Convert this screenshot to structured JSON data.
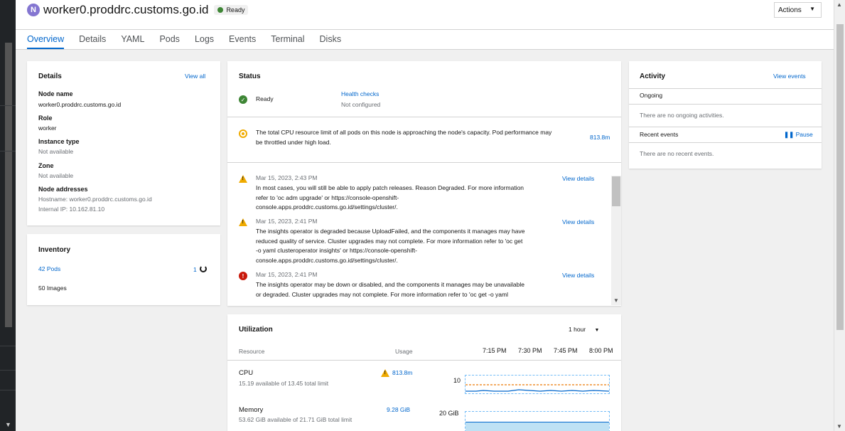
{
  "header": {
    "node_badge": "N",
    "title": "worker0.proddrc.customs.go.id",
    "status": "Ready",
    "actions_label": "Actions"
  },
  "tabs": [
    {
      "label": "Overview",
      "active": true
    },
    {
      "label": "Details"
    },
    {
      "label": "YAML"
    },
    {
      "label": "Pods"
    },
    {
      "label": "Logs"
    },
    {
      "label": "Events"
    },
    {
      "label": "Terminal"
    },
    {
      "label": "Disks"
    }
  ],
  "details": {
    "title": "Details",
    "view_all": "View all",
    "node_name_label": "Node name",
    "node_name": "worker0.proddrc.customs.go.id",
    "role_label": "Role",
    "role": "worker",
    "instance_type_label": "Instance type",
    "instance_type": "Not available",
    "zone_label": "Zone",
    "zone": "Not available",
    "addresses_label": "Node addresses",
    "hostname": "Hostname: worker0.proddrc.customs.go.id",
    "internal_ip": "Internal IP: 10.162.81.10"
  },
  "inventory": {
    "title": "Inventory",
    "pods": "42 Pods",
    "pods_pending": "1",
    "images": "50 Images"
  },
  "status": {
    "title": "Status",
    "ready": "Ready",
    "health_checks": "Health checks",
    "health_status": "Not configured",
    "cpu_alert": "The total CPU resource limit of all pods on this node is approaching the node's capacity. Pod performance may be throttled under high load.",
    "cpu_alert_value": "813.8m",
    "alerts": [
      {
        "severity": "warning",
        "date": "Mar 15, 2023, 2:43 PM",
        "lines": [
          "In most cases, you will still be able to apply patch releases. Reason Degraded. For more information",
          "refer to 'oc adm upgrade' or https://console-openshift-",
          "console.apps.proddrc.customs.go.id/settings/cluster/."
        ],
        "link": "View details"
      },
      {
        "severity": "warning",
        "date": "Mar 15, 2023, 2:41 PM",
        "lines": [
          "The insights operator is degraded because UploadFailed, and the components it manages may have",
          "reduced quality of service. Cluster upgrades may not complete. For more information refer to 'oc get",
          "-o yaml clusteroperator insights' or https://console-openshift-",
          "console.apps.proddrc.customs.go.id/settings/cluster/."
        ],
        "link": "View details"
      },
      {
        "severity": "critical",
        "date": "Mar 15, 2023, 2:41 PM",
        "lines": [
          "The insights operator may be down or disabled, and the components it manages may be unavailable",
          "or degraded. Cluster upgrades may not complete. For more information refer to 'oc get -o yaml"
        ],
        "link": "View details"
      }
    ]
  },
  "activity": {
    "title": "Activity",
    "view_events": "View events",
    "ongoing_label": "Ongoing",
    "ongoing_empty": "There are no ongoing activities.",
    "recent_label": "Recent events",
    "pause": "Pause",
    "recent_empty": "There are no recent events."
  },
  "utilization": {
    "title": "Utilization",
    "range": "1 hour",
    "col_resource": "Resource",
    "col_usage": "Usage",
    "ticks": [
      "7:15 PM",
      "7:30 PM",
      "7:45 PM",
      "8:00 PM"
    ],
    "rows": [
      {
        "name": "CPU",
        "detail": "15.19 available of 13.45 total limit",
        "usage": "813.8m",
        "warning": true,
        "axis_label": "10"
      },
      {
        "name": "Memory",
        "detail": "53.62 GiB available of 21.71 GiB total limit",
        "usage": "9.28 GiB",
        "warning": false,
        "axis_label": "20 GiB"
      }
    ]
  },
  "colors": {
    "link": "#0066cc",
    "success": "#3e8635",
    "warning": "#f0ab00",
    "danger": "#c9190b",
    "badge": "#8476d1"
  }
}
